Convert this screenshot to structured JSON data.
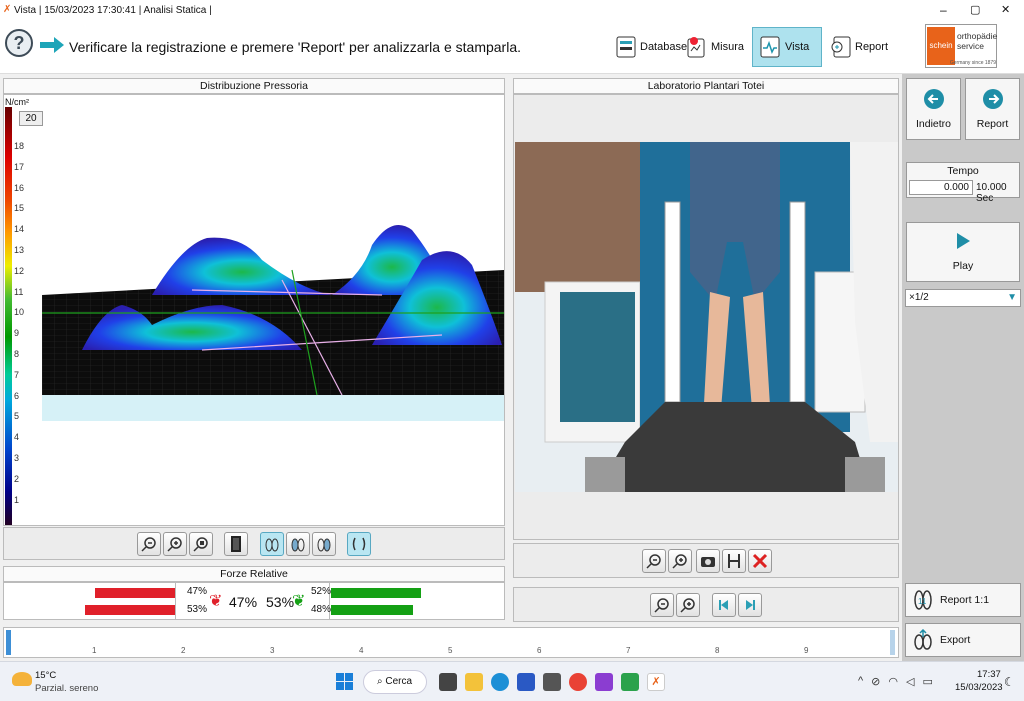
{
  "window": {
    "title": "Vista | 15/03/2023 17:30:41 | Analisi Statica |",
    "minimize": "–",
    "maximize": "▢",
    "close": "✕"
  },
  "toolbar": {
    "help": "?",
    "instruction": "Verificare la registrazione e premere 'Report' per analizzarla e stamparla.",
    "tabs": [
      {
        "label": "Database"
      },
      {
        "label": "Misura"
      },
      {
        "label": "Vista"
      },
      {
        "label": "Report"
      }
    ],
    "logo": {
      "brand1": "schein",
      "brand2": "orthopädie service",
      "tagline": "Germany since 1879"
    }
  },
  "pressure": {
    "title": "Distribuzione Pressoria",
    "unit": "N/cm²",
    "max_value": "20",
    "scale": [
      "18",
      "17",
      "16",
      "15",
      "14",
      "13",
      "12",
      "11",
      "10",
      "9",
      "8",
      "7",
      "6",
      "5",
      "4",
      "3",
      "2",
      "1"
    ]
  },
  "video": {
    "title": "Laboratorio Plantari Totei"
  },
  "forces": {
    "title": "Forze Relative",
    "left_top": "47%",
    "left_bottom": "53%",
    "left_total": "47%",
    "right_total": "53%",
    "right_top": "52%",
    "right_bottom": "48%"
  },
  "timeline": {
    "ticks": [
      "1",
      "2",
      "3",
      "4",
      "5",
      "6",
      "7",
      "8",
      "9"
    ]
  },
  "side": {
    "back": "Indietro",
    "report": "Report",
    "tempo_label": "Tempo",
    "tempo_current": "0.000",
    "tempo_total": "10.000 Sec",
    "play": "Play",
    "speed": "×1/2",
    "report11": "Report 1:1",
    "export": "Export"
  },
  "taskbar": {
    "temp": "15°C",
    "weather": "Parzial. sereno",
    "search": "Cerca",
    "time": "17:37",
    "date": "15/03/2023"
  }
}
